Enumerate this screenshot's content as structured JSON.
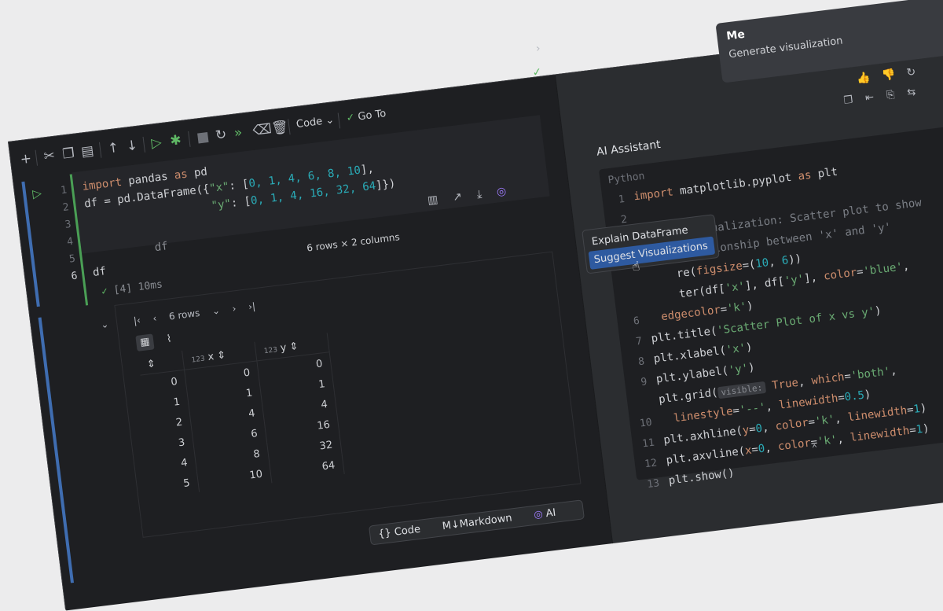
{
  "toolbar": {
    "cell_type": "Code",
    "goto_label": "Go To",
    "icons": [
      "add-icon",
      "cut-icon",
      "copy-icon",
      "paste-icon",
      "move-up-icon",
      "move-down-icon",
      "run-and-select-below-icon",
      "debug-icon",
      "stop-icon",
      "restart-icon",
      "run-all-icon",
      "clear-outputs-icon",
      "delete-cell-icon",
      "chevron-down-icon",
      "check-icon"
    ]
  },
  "editor": {
    "line_numbers": [
      "1",
      "2",
      "3",
      "4",
      "5",
      "6"
    ],
    "code": {
      "l1_kw_import": "import",
      "l1_mod": " pandas ",
      "l1_kw_as": "as",
      "l1_alias": " pd",
      "l2_prefix": "df = pd.DataFrame({",
      "l2_key": "\"x\"",
      "l2_mid": ": [",
      "l2_nums": "0, 1, 4, 6, 8, 10",
      "l2_end": "],",
      "l3_key": "\"y\"",
      "l3_mid": ": [",
      "l3_nums": "0, 1, 4, 16, 32, 64",
      "l3_end": "]})",
      "l6": "df"
    },
    "hint_df": "df",
    "run_status": "[4] 10ms"
  },
  "output": {
    "summary": "6 rows × 2 columns",
    "rows_select": "6 rows",
    "columns": [
      {
        "type": "123",
        "name": "x"
      },
      {
        "type": "123",
        "name": "y"
      }
    ],
    "index": [
      "0",
      "1",
      "2",
      "3",
      "4",
      "5"
    ],
    "x_values": [
      "0",
      "1",
      "4",
      "6",
      "8",
      "10"
    ],
    "y_values": [
      "0",
      "1",
      "4",
      "16",
      "32",
      "64"
    ]
  },
  "add_cell": {
    "code": "Code",
    "markdown": "Markdown",
    "ai": "AI"
  },
  "context_menu": {
    "items": [
      "Explain DataFrame",
      "Suggest Visualizations"
    ],
    "selected_index": 1
  },
  "ai_panel": {
    "me_label": "Me",
    "me_message": "Generate visualization",
    "title": "AI Assistant",
    "snippet_lang": "Python",
    "line_numbers": [
      "1",
      "2",
      "3",
      "",
      "",
      "",
      "6",
      "7",
      "8",
      "9",
      "10",
      "11",
      "12",
      "13"
    ],
    "code": {
      "l1_kw": "import",
      "l1_rest": " matplotlib.pyplot ",
      "l1_as": "as",
      "l1_alias": " plt",
      "l3": "# First visualization: Scatter plot to show",
      "l3b": "  the relationship between 'x' and 'y'",
      "l4a": "     re(",
      "l4_param": "figsize",
      "l4b": "=(",
      "l4_n1": "10",
      "l4_c": ", ",
      "l4_n2": "6",
      "l4_end": "))",
      "l5a": "     ter(df[",
      "l5_s1": "'x'",
      "l5b": "], df[",
      "l5_s2": "'y'",
      "l5c": "], ",
      "l5_param": "color",
      "l5d": "=",
      "l5_s3": "'blue'",
      "l5e": ",",
      "l5f_param": "edgecolor",
      "l5f_eq": "=",
      "l5f_s": "'k'",
      "l5f_end": ")",
      "l6a": "plt.title(",
      "l6_s": "'Scatter Plot of x vs y'",
      "l6b": ")",
      "l7a": "plt.xlabel(",
      "l7_s": "'x'",
      "l7b": ")",
      "l8a": "plt.ylabel(",
      "l8_s": "'y'",
      "l8b": ")",
      "l9a": "plt.grid(",
      "l9_hint": "visible:",
      "l9_kw": " True",
      "l9b": ", ",
      "l9_param": "which",
      "l9c": "=",
      "l9_s": "'both'",
      "l9d": ",",
      "l9e_param": "linestyle",
      "l9e_eq": "=",
      "l9e_s": "'--'",
      "l9e_c": ", ",
      "l9e_param2": "linewidth",
      "l9e_eq2": "=",
      "l9e_n": "0.5",
      "l9e_end": ")",
      "l10a": "plt.axhline(",
      "l10_p1": "y",
      "l10_eq": "=",
      "l10_n": "0",
      "l10_c": ", ",
      "l10_p2": "color",
      "l10_eq2": "=",
      "l10_s": "'k'",
      "l10_c2": ", ",
      "l10_p3": "linewidth",
      "l10_eq3": "=",
      "l10_n2": "1",
      "l10_end": ")",
      "l11a": "plt.axvline(",
      "l11_p1": "x",
      "l11_eq": "=",
      "l11_n": "0",
      "l11_c": ", ",
      "l11_p2": "color",
      "l11_eq2": "=",
      "l11_s": "'k'",
      "l11_c2": ", ",
      "l11_p3": "linewidth",
      "l11_eq3": "=",
      "l11_n2": "1",
      "l11_end": ")",
      "l12": "plt.show()"
    }
  },
  "colors": {
    "background": "#ececed",
    "editor_bg": "#1e1f22",
    "accent_blue": "#2e5aa0",
    "run_green": "#5fb865",
    "ai_purple": "#9f7bff"
  }
}
